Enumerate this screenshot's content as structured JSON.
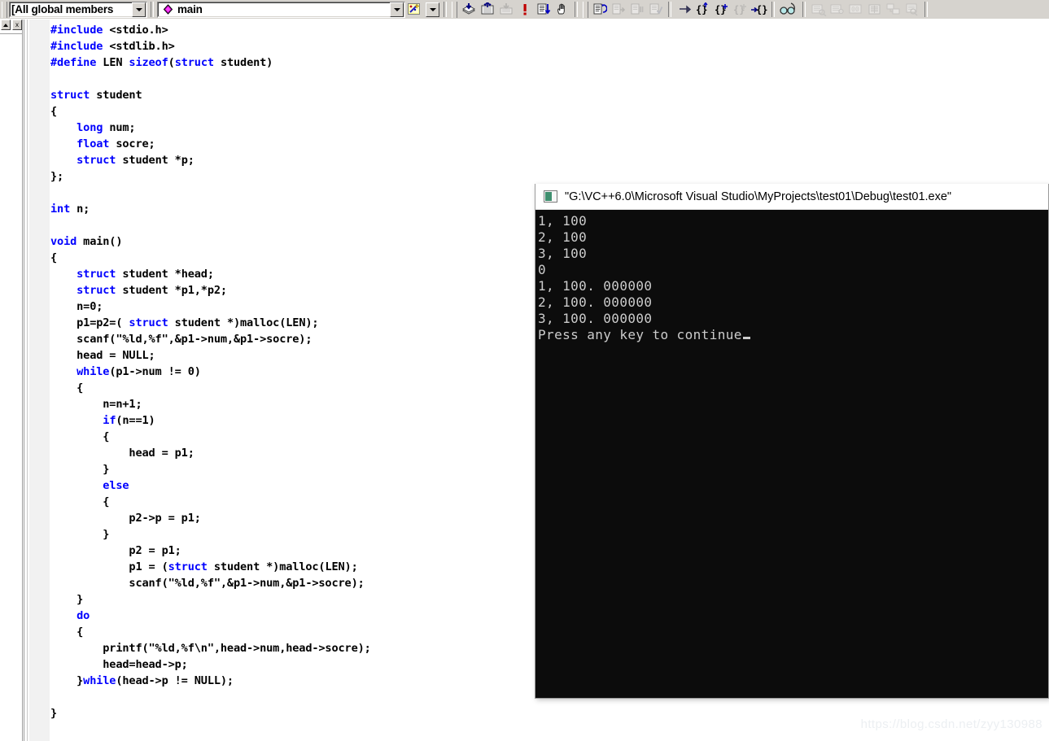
{
  "toolbar": {
    "members_combo": {
      "value": "[All global members",
      "dropdown_icon": "chevron-down-icon"
    },
    "function_combo": {
      "value": "main",
      "symbol_icon": "class-member-icon",
      "dropdown_icon": "chevron-down-icon"
    },
    "wizard_button": {
      "icon": "wizardbar-icon",
      "label": ""
    },
    "wizard_dropdown": {
      "icon": "chevron-down-icon"
    },
    "buttons": [
      {
        "name": "compile-button",
        "icon": "compile-icon",
        "enabled": true
      },
      {
        "name": "build-button",
        "icon": "build-icon",
        "enabled": true
      },
      {
        "name": "stop-build-button",
        "icon": "stop-build-icon",
        "enabled": false
      },
      {
        "name": "execute-button",
        "icon": "exclamation-run-icon",
        "enabled": true
      },
      {
        "name": "go-button",
        "icon": "go-debug-icon",
        "enabled": true
      },
      {
        "name": "insert-breakpoint",
        "icon": "hand-breakpoint-icon",
        "enabled": true
      },
      {
        "name": "restart-button",
        "icon": "restart-debug-icon",
        "enabled": true
      },
      {
        "name": "stop-debugging-button",
        "icon": "stop-debug-icon",
        "enabled": false
      },
      {
        "name": "break-execution-button",
        "icon": "break-execution-icon",
        "enabled": false
      },
      {
        "name": "apply-code-changes",
        "icon": "apply-code-changes-icon",
        "enabled": false
      },
      {
        "name": "step-into-button",
        "icon": "step-arrow-icon",
        "enabled": true
      },
      {
        "name": "step-over-button",
        "icon": "braces-step-icon",
        "enabled": true
      },
      {
        "name": "step-out-button",
        "icon": "braces-plus-icon",
        "enabled": true
      },
      {
        "name": "step-return-button",
        "icon": "braces-faded-icon",
        "enabled": false
      },
      {
        "name": "run-to-cursor-button",
        "icon": "braces-arrow-icon",
        "enabled": true
      },
      {
        "name": "quickwatch-button",
        "icon": "glasses-quickwatch-icon",
        "enabled": true
      },
      {
        "name": "watch-window-button",
        "icon": "watch-window-icon",
        "enabled": false
      },
      {
        "name": "variables-window",
        "icon": "variables-window-icon",
        "enabled": false
      },
      {
        "name": "registers-window",
        "icon": "registers-window-icon",
        "enabled": false
      },
      {
        "name": "memory-window",
        "icon": "memory-window-icon",
        "enabled": false
      },
      {
        "name": "call-stack-window",
        "icon": "call-stack-icon",
        "enabled": false
      },
      {
        "name": "disassembly-window",
        "icon": "disassembly-icon",
        "enabled": false
      }
    ]
  },
  "left_dock": {
    "minimize_button": {
      "icon": "up-arrow-icon"
    },
    "close_button": {
      "icon": "close-x-icon",
      "label": "x"
    }
  },
  "editor": {
    "language": "C",
    "code_lines": [
      [
        {
          "t": "#include",
          "c": "pp"
        },
        {
          "t": " <stdio.h>",
          "c": ""
        }
      ],
      [
        {
          "t": "#include",
          "c": "pp"
        },
        {
          "t": " <stdlib.h>",
          "c": ""
        }
      ],
      [
        {
          "t": "#define",
          "c": "pp"
        },
        {
          "t": " LEN ",
          "c": ""
        },
        {
          "t": "sizeof",
          "c": "kw"
        },
        {
          "t": "(",
          "c": ""
        },
        {
          "t": "struct",
          "c": "kw"
        },
        {
          "t": " student)",
          "c": ""
        }
      ],
      [
        {
          "t": "",
          "c": ""
        }
      ],
      [
        {
          "t": "struct",
          "c": "kw"
        },
        {
          "t": " student",
          "c": ""
        }
      ],
      [
        {
          "t": "{",
          "c": ""
        }
      ],
      [
        {
          "t": "    ",
          "c": ""
        },
        {
          "t": "long",
          "c": "kw"
        },
        {
          "t": " num;",
          "c": ""
        }
      ],
      [
        {
          "t": "    ",
          "c": ""
        },
        {
          "t": "float",
          "c": "kw"
        },
        {
          "t": " socre;",
          "c": ""
        }
      ],
      [
        {
          "t": "    ",
          "c": ""
        },
        {
          "t": "struct",
          "c": "kw"
        },
        {
          "t": " student *p;",
          "c": ""
        }
      ],
      [
        {
          "t": "};",
          "c": ""
        }
      ],
      [
        {
          "t": "",
          "c": ""
        }
      ],
      [
        {
          "t": "int",
          "c": "kw"
        },
        {
          "t": " n;",
          "c": ""
        }
      ],
      [
        {
          "t": "",
          "c": ""
        }
      ],
      [
        {
          "t": "void",
          "c": "kw"
        },
        {
          "t": " main()",
          "c": ""
        }
      ],
      [
        {
          "t": "{",
          "c": ""
        }
      ],
      [
        {
          "t": "    ",
          "c": ""
        },
        {
          "t": "struct",
          "c": "kw"
        },
        {
          "t": " student *head;",
          "c": ""
        }
      ],
      [
        {
          "t": "    ",
          "c": ""
        },
        {
          "t": "struct",
          "c": "kw"
        },
        {
          "t": " student *p1,*p2;",
          "c": ""
        }
      ],
      [
        {
          "t": "    n=0;",
          "c": ""
        }
      ],
      [
        {
          "t": "    p1=p2=( ",
          "c": ""
        },
        {
          "t": "struct",
          "c": "kw"
        },
        {
          "t": " student *)malloc(LEN);",
          "c": ""
        }
      ],
      [
        {
          "t": "    scanf(\"%ld,%f\",&p1->num,&p1->socre);",
          "c": ""
        }
      ],
      [
        {
          "t": "    head = NULL;",
          "c": ""
        }
      ],
      [
        {
          "t": "    ",
          "c": ""
        },
        {
          "t": "while",
          "c": "kw"
        },
        {
          "t": "(p1->num != 0)",
          "c": ""
        }
      ],
      [
        {
          "t": "    {",
          "c": ""
        }
      ],
      [
        {
          "t": "        n=n+1;",
          "c": ""
        }
      ],
      [
        {
          "t": "        ",
          "c": ""
        },
        {
          "t": "if",
          "c": "kw"
        },
        {
          "t": "(n==1)",
          "c": ""
        }
      ],
      [
        {
          "t": "        {",
          "c": ""
        }
      ],
      [
        {
          "t": "            head = p1;",
          "c": ""
        }
      ],
      [
        {
          "t": "        }",
          "c": ""
        }
      ],
      [
        {
          "t": "        ",
          "c": ""
        },
        {
          "t": "else",
          "c": "kw"
        }
      ],
      [
        {
          "t": "        {",
          "c": ""
        }
      ],
      [
        {
          "t": "            p2->p = p1;",
          "c": ""
        }
      ],
      [
        {
          "t": "        }",
          "c": ""
        }
      ],
      [
        {
          "t": "            p2 = p1;",
          "c": ""
        }
      ],
      [
        {
          "t": "            p1 = (",
          "c": ""
        },
        {
          "t": "struct",
          "c": "kw"
        },
        {
          "t": " student *)malloc(LEN);",
          "c": ""
        }
      ],
      [
        {
          "t": "            scanf(\"%ld,%f\",&p1->num,&p1->socre);",
          "c": ""
        }
      ],
      [
        {
          "t": "    }",
          "c": ""
        }
      ],
      [
        {
          "t": "    ",
          "c": ""
        },
        {
          "t": "do",
          "c": "kw"
        }
      ],
      [
        {
          "t": "    {",
          "c": ""
        }
      ],
      [
        {
          "t": "        printf(\"%ld,%f\\n\",head->num,head->socre);",
          "c": ""
        }
      ],
      [
        {
          "t": "        head=head->p;",
          "c": ""
        }
      ],
      [
        {
          "t": "    }",
          "c": ""
        },
        {
          "t": "while",
          "c": "kw"
        },
        {
          "t": "(head->p != NULL);",
          "c": ""
        }
      ],
      [
        {
          "t": "",
          "c": ""
        }
      ],
      [
        {
          "t": "}",
          "c": ""
        }
      ]
    ]
  },
  "console": {
    "title": "\"G:\\VC++6.0\\Microsoft Visual Studio\\MyProjects\\test01\\Debug\\test01.exe\"",
    "icon": "console-window-icon",
    "output_lines": [
      "1, 100",
      "2, 100",
      "3, 100",
      "0",
      "1, 100. 000000",
      "2, 100. 000000",
      "3, 100. 000000",
      "Press any key to continue"
    ],
    "has_cursor": true
  },
  "watermark": {
    "text": "https://blog.csdn.net/zyy130988"
  },
  "colors": {
    "toolbar_bg": "#d6d3ce",
    "keyword_blue": "#0000ff",
    "console_bg": "#0c0c0c",
    "console_fg": "#cccccc",
    "editor_bg": "#ffffff",
    "gutter_bg": "#f1f1f1"
  }
}
